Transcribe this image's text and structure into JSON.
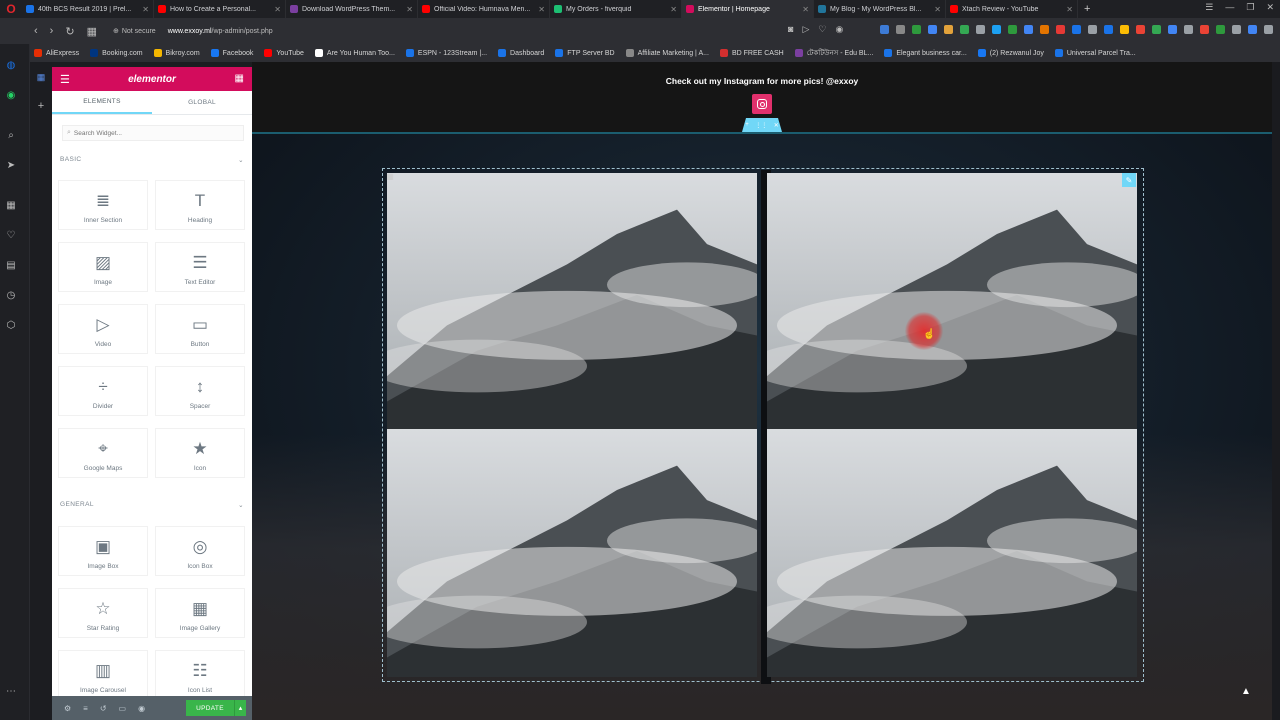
{
  "browser": {
    "tabs": [
      {
        "title": "40th BCS Result 2019 | Prel...",
        "color": "#1a73e8"
      },
      {
        "title": "How to Create a Personal...",
        "color": "#ff0000"
      },
      {
        "title": "Download WordPress Them...",
        "color": "#7b3fa0"
      },
      {
        "title": "Official Video: Humnava Men...",
        "color": "#ff0000"
      },
      {
        "title": "My Orders - fiverquid",
        "color": "#1dbf73"
      },
      {
        "title": "Elementor | Homepage",
        "color": "#d30c5c",
        "active": true
      },
      {
        "title": "My Blog - My WordPress Bl...",
        "color": "#21759b"
      },
      {
        "title": "Xtach Review - YouTube",
        "color": "#ff0000"
      }
    ],
    "new_tab_label": "+",
    "security_label": "Not secure",
    "url_domain": "www.exxoy.ml",
    "url_path": "/wp-admin/post.php",
    "bookmarks": [
      {
        "label": "AliExpress",
        "color": "#e62e04"
      },
      {
        "label": "Booking.com",
        "color": "#003580"
      },
      {
        "label": "Bikroy.com",
        "color": "#f5b700"
      },
      {
        "label": "Facebook",
        "color": "#1877f2"
      },
      {
        "label": "YouTube",
        "color": "#ff0000"
      },
      {
        "label": "Are You Human Too...",
        "color": "#ffffff"
      },
      {
        "label": "ESPN - 123Stream |...",
        "color": "#1a73e8"
      },
      {
        "label": "Dashboard",
        "color": "#1a73e8"
      },
      {
        "label": "FTP Server BD",
        "color": "#1a73e8"
      },
      {
        "label": "Affiliate Marketing | A...",
        "color": "#888888"
      },
      {
        "label": "BD FREE CASH",
        "color": "#d32f2f"
      },
      {
        "label": "টেকটিউনস - Edu BL...",
        "color": "#7b3fa0"
      },
      {
        "label": "Elegant business car...",
        "color": "#1a73e8"
      },
      {
        "label": "(2) Rezwanul Joy",
        "color": "#1877f2"
      },
      {
        "label": "Universal Parcel Tra...",
        "color": "#1a73e8"
      }
    ]
  },
  "elementor": {
    "logo": "elementor",
    "tabs": [
      "ELEMENTS",
      "GLOBAL"
    ],
    "search_placeholder": "Search Widget...",
    "categories": {
      "basic": "BASIC",
      "general": "GENERAL"
    },
    "widgets": [
      {
        "label": "Inner Section",
        "icon": "≣"
      },
      {
        "label": "Heading",
        "icon": "T"
      },
      {
        "label": "Image",
        "icon": "▨"
      },
      {
        "label": "Text Editor",
        "icon": "☰"
      },
      {
        "label": "Video",
        "icon": "▷"
      },
      {
        "label": "Button",
        "icon": "▭"
      },
      {
        "label": "Divider",
        "icon": "÷"
      },
      {
        "label": "Spacer",
        "icon": "↕"
      },
      {
        "label": "Google Maps",
        "icon": "⌖"
      },
      {
        "label": "Icon",
        "icon": "★"
      },
      {
        "label": "Image Box",
        "icon": "▣"
      },
      {
        "label": "Icon Box",
        "icon": "◎"
      },
      {
        "label": "Star Rating",
        "icon": "☆"
      },
      {
        "label": "Image Gallery",
        "icon": "▦"
      },
      {
        "label": "Image Carousel",
        "icon": "▥"
      },
      {
        "label": "Icon List",
        "icon": "☷"
      }
    ],
    "update_label": "UPDATE"
  },
  "preview": {
    "instagram_text": "Check out my Instagram for more pics! @exxoy",
    "accent_color": "#71d7f7",
    "brand_color": "#d30c5c"
  }
}
